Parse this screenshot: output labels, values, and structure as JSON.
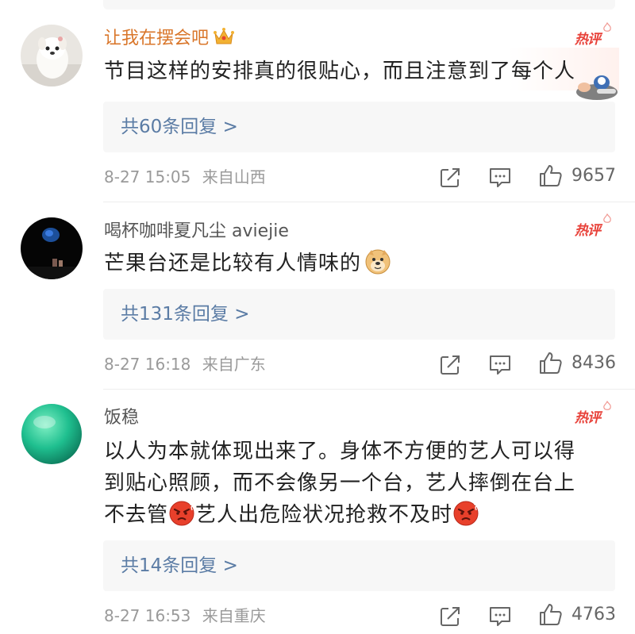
{
  "comments": [
    {
      "username": "让我在摆会吧",
      "badge": "热评",
      "content": "节目这样的安排真的很贴心，而且注意到了每个人",
      "reply_link": "共60条回复 >",
      "date": "8-27 15:05",
      "location": "来自山西",
      "likes": "9657",
      "username_color": "#d9762a"
    },
    {
      "username": "喝杯咖啡夏凡尘 aviejie",
      "badge": "热评",
      "content": "芒果台还是比较有人情味的",
      "reply_link": "共131条回复 >",
      "date": "8-27 16:18",
      "location": "来自广东",
      "likes": "8436"
    },
    {
      "username": "饭稳",
      "badge": "热评",
      "content_lines": [
        "以人为本就体现出来了。身体不方便的艺人可以得",
        "到贴心照顾，而不会像另一个台，艺人摔倒在台上",
        "不去管",
        "艺人出危险状况抢救不及时"
      ],
      "reply_link": "共14条回复 >",
      "date": "8-27 16:53",
      "location": "来自重庆",
      "likes": "4763"
    }
  ],
  "icons": {
    "share": "share-icon",
    "comment": "comment-icon",
    "like": "thumbs-up-icon",
    "crown": "crown-icon",
    "doge": "doge-emoji-icon",
    "angry": "angry-face-emoji-icon"
  },
  "colors": {
    "accent_link": "#5b7ca5",
    "hot_badge": "#e8423a",
    "meta_text": "#9a9a9a"
  }
}
